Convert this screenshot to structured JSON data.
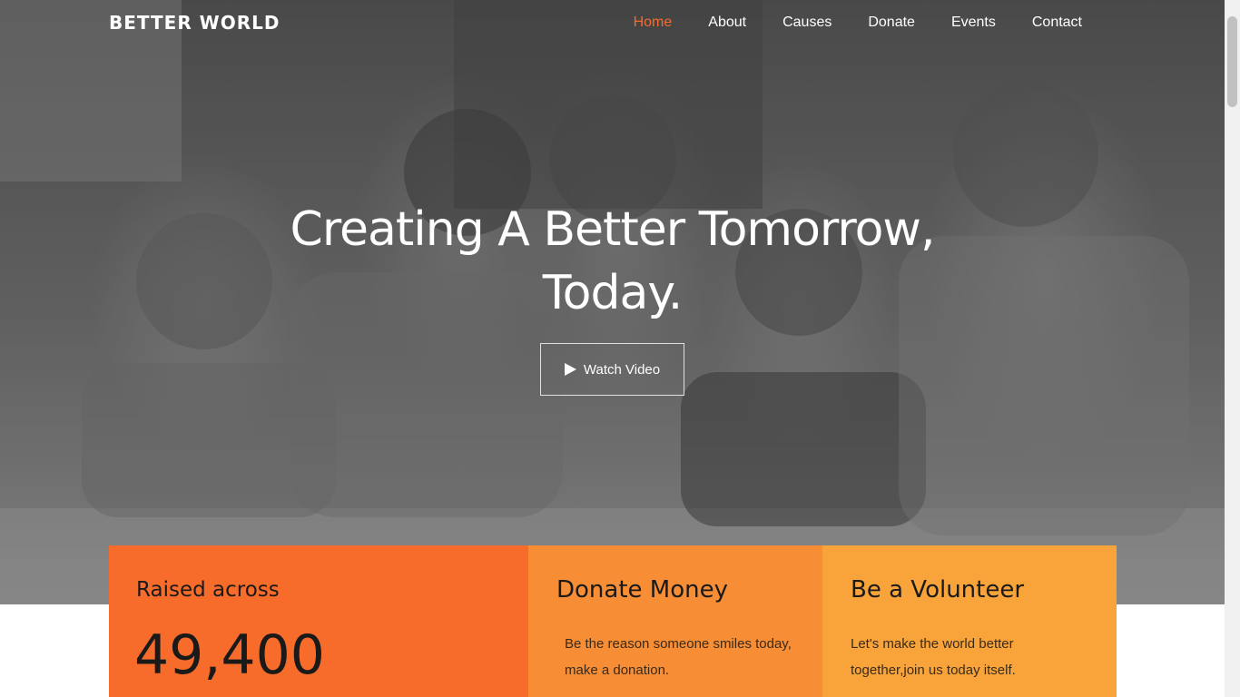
{
  "brand": {
    "logo": "BETTER WORLD"
  },
  "nav": {
    "items": [
      {
        "label": "Home",
        "active": true
      },
      {
        "label": "About"
      },
      {
        "label": "Causes"
      },
      {
        "label": "Donate"
      },
      {
        "label": "Events"
      },
      {
        "label": "Contact"
      }
    ]
  },
  "hero": {
    "title_line1": "Creating A Better Tomorrow,",
    "title_line2": "Today.",
    "watch_label": "Watch Video",
    "play_icon": "play-icon"
  },
  "cards": {
    "raised": {
      "label": "Raised across",
      "value": "49,400"
    },
    "donate": {
      "title": "Donate Money",
      "text": "Be the reason someone smiles today, make a donation."
    },
    "volunteer": {
      "title": "Be a Volunteer",
      "text": "Let's make the world better together,join us today itself."
    }
  },
  "colors": {
    "accent": "#f76c2b",
    "card_raised": "#f76c2b",
    "card_donate": "#f78d34",
    "card_volunteer": "#f9a43a"
  }
}
